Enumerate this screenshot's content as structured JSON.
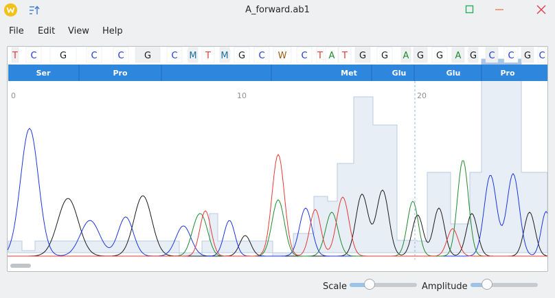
{
  "window": {
    "title": "A_forward.ab1"
  },
  "menu": [
    "File",
    "Edit",
    "View",
    "Help"
  ],
  "bases": [
    {
      "b": "T",
      "c": "#e53935",
      "q": "low"
    },
    {
      "b": "C",
      "c": "#1a35e0",
      "q": "high"
    },
    {
      "b": "G",
      "c": "#1a1a1a",
      "q": "high"
    },
    {
      "b": "C",
      "c": "#1a35e0",
      "q": "high"
    },
    {
      "b": "C",
      "c": "#1a35e0",
      "q": "high"
    },
    {
      "b": "G",
      "c": "#1a1a1a",
      "q": "low"
    },
    {
      "b": "C",
      "c": "#1a35e0",
      "q": "high"
    },
    {
      "b": "M",
      "c": "#1c6ea4",
      "q": "low"
    },
    {
      "b": "T",
      "c": "#e53935",
      "q": "high"
    },
    {
      "b": "M",
      "c": "#1c6ea4",
      "q": "low"
    },
    {
      "b": "G",
      "c": "#1a1a1a",
      "q": "high"
    },
    {
      "b": "C",
      "c": "#1a35e0",
      "q": "high"
    },
    {
      "b": "W",
      "c": "#9a5b14",
      "q": "high"
    },
    {
      "b": "C",
      "c": "#1a35e0",
      "q": "high"
    },
    {
      "b": "T",
      "c": "#e53935",
      "q": "high"
    },
    {
      "b": "A",
      "c": "#1f8a2e",
      "q": "high"
    },
    {
      "b": "T",
      "c": "#e53935",
      "q": "high"
    },
    {
      "b": "G",
      "c": "#1a1a1a",
      "q": "low"
    },
    {
      "b": "G",
      "c": "#1a1a1a",
      "q": "high"
    },
    {
      "b": "A",
      "c": "#1f8a2e",
      "q": "low"
    },
    {
      "b": "G",
      "c": "#1a1a1a",
      "q": "low"
    },
    {
      "b": "G",
      "c": "#1a1a1a",
      "q": "high"
    },
    {
      "b": "A",
      "c": "#1f8a2e",
      "q": "low"
    },
    {
      "b": "G",
      "c": "#1a1a1a",
      "q": "low"
    },
    {
      "b": "C",
      "c": "#1a35e0",
      "q": "low"
    },
    {
      "b": "C",
      "c": "#1a35e0",
      "q": "high"
    },
    {
      "b": "G",
      "c": "#1a1a1a",
      "q": "low"
    },
    {
      "b": "C",
      "c": "#1a35e0",
      "q": "high"
    }
  ],
  "amino_acids": [
    "Ser",
    "Pro",
    "Met",
    "Glu",
    "Glu",
    "Pro"
  ],
  "ruler": [
    "0",
    "10",
    "20"
  ],
  "status": {
    "scale_label": "Scale",
    "amplitude_label": "Amplitude",
    "scale": 0.25,
    "amplitude": 0.2
  },
  "colors": {
    "A": "#1f8a2e",
    "C": "#1a35e0",
    "G": "#1a1a1a",
    "T": "#e53935",
    "aa_bar": "#2f86dd",
    "selection": "#8eb6e3"
  },
  "icons": [
    "app-logo-icon",
    "sort-icon",
    "maximize-icon",
    "minimize-icon",
    "close-icon"
  ]
}
